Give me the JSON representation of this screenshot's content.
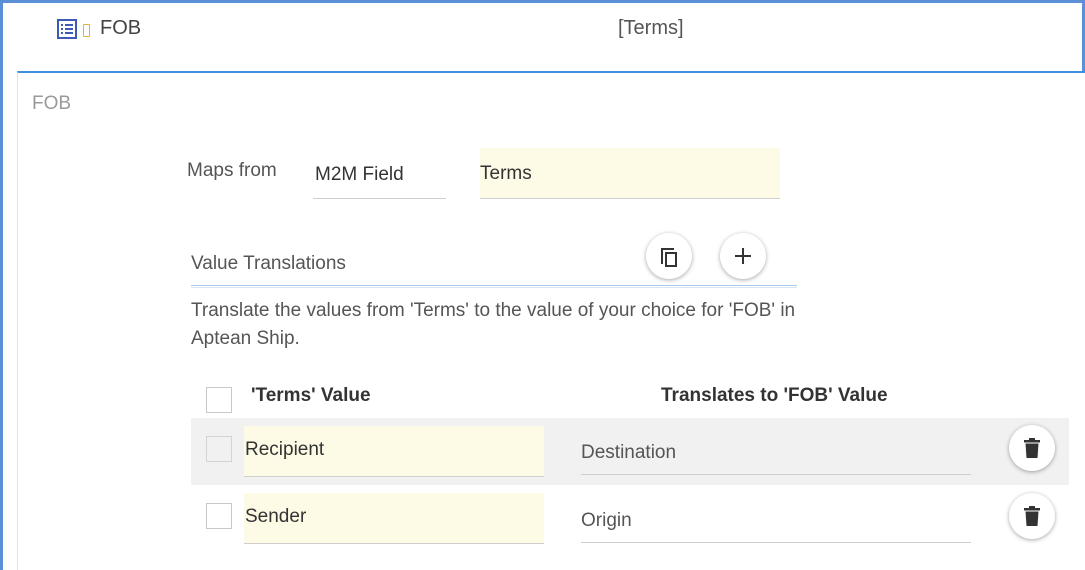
{
  "header": {
    "field_name": "FOB",
    "source_field": "[Terms]",
    "list_icon": "list-icon",
    "lock_icon": "lock-icon"
  },
  "panel": {
    "title": "FOB",
    "maps_from_label": "Maps from",
    "source_type": "M2M Field",
    "source_field_value": "Terms",
    "value_translations_label": "Value Translations",
    "copy_icon": "copy-icon",
    "add_icon": "plus-icon",
    "description": "Translate the values from 'Terms' to the value of your choice for 'FOB' in Aptean Ship.",
    "columns": {
      "source": "'Terms' Value",
      "target": "Translates to 'FOB' Value"
    },
    "rows": [
      {
        "source": "Recipient",
        "target": "Destination",
        "delete_icon": "trash-icon"
      },
      {
        "source": "Sender",
        "target": "Origin",
        "delete_icon": "trash-icon"
      }
    ]
  },
  "colors": {
    "frame_border": "#5b8fd6",
    "panel_accent": "#3d8fe0",
    "input_background": "#fdfae6",
    "row_highlight": "#f1f1f1",
    "lock_icon": "#e0b33a",
    "list_icon": "#3b5bb5"
  }
}
